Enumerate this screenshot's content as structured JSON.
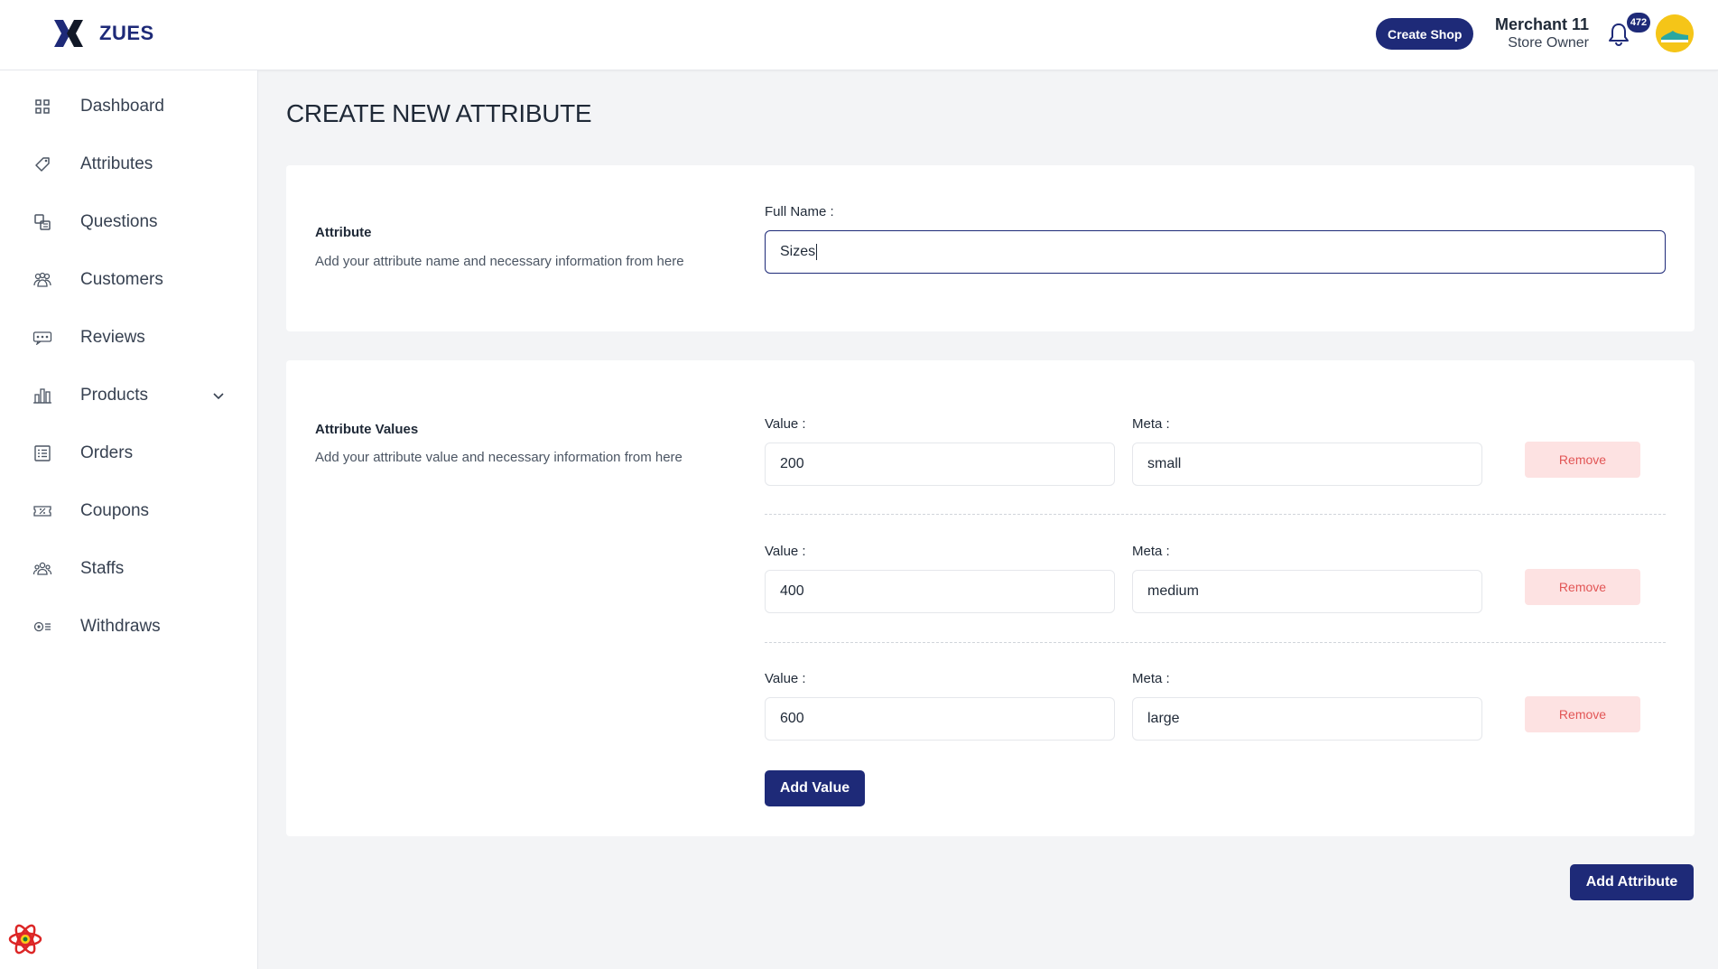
{
  "app": {
    "brand": "ZUES",
    "create_shop_label": "Create Shop",
    "user": {
      "name": "Merchant 11",
      "role": "Store Owner"
    },
    "notifications_count": "472",
    "accent_color": "#1e2a78"
  },
  "sidebar": {
    "items": [
      {
        "label": "Dashboard",
        "icon": "dashboard-grid-icon"
      },
      {
        "label": "Attributes",
        "icon": "tag-icon"
      },
      {
        "label": "Questions",
        "icon": "questions-icon"
      },
      {
        "label": "Customers",
        "icon": "customers-icon"
      },
      {
        "label": "Reviews",
        "icon": "reviews-icon"
      },
      {
        "label": "Products",
        "icon": "products-icon",
        "expandable": true
      },
      {
        "label": "Orders",
        "icon": "orders-list-icon"
      },
      {
        "label": "Coupons",
        "icon": "coupon-icon"
      },
      {
        "label": "Staffs",
        "icon": "staffs-icon"
      },
      {
        "label": "Withdraws",
        "icon": "withdraw-icon"
      }
    ]
  },
  "page": {
    "title": "CREATE NEW ATTRIBUTE"
  },
  "attribute_section": {
    "title": "Attribute",
    "description": "Add your attribute name and necessary information from here",
    "full_name_label": "Full Name :",
    "full_name_value": "Sizes"
  },
  "values_section": {
    "title": "Attribute Values",
    "description": "Add your attribute value and necessary information from here",
    "value_label": "Value :",
    "meta_label": "Meta :",
    "remove_label": "Remove",
    "rows": [
      {
        "value": "200",
        "meta": "small"
      },
      {
        "value": "400",
        "meta": "medium"
      },
      {
        "value": "600",
        "meta": "large"
      }
    ],
    "add_value_label": "Add Value"
  },
  "footer": {
    "add_attribute_label": "Add Attribute"
  }
}
